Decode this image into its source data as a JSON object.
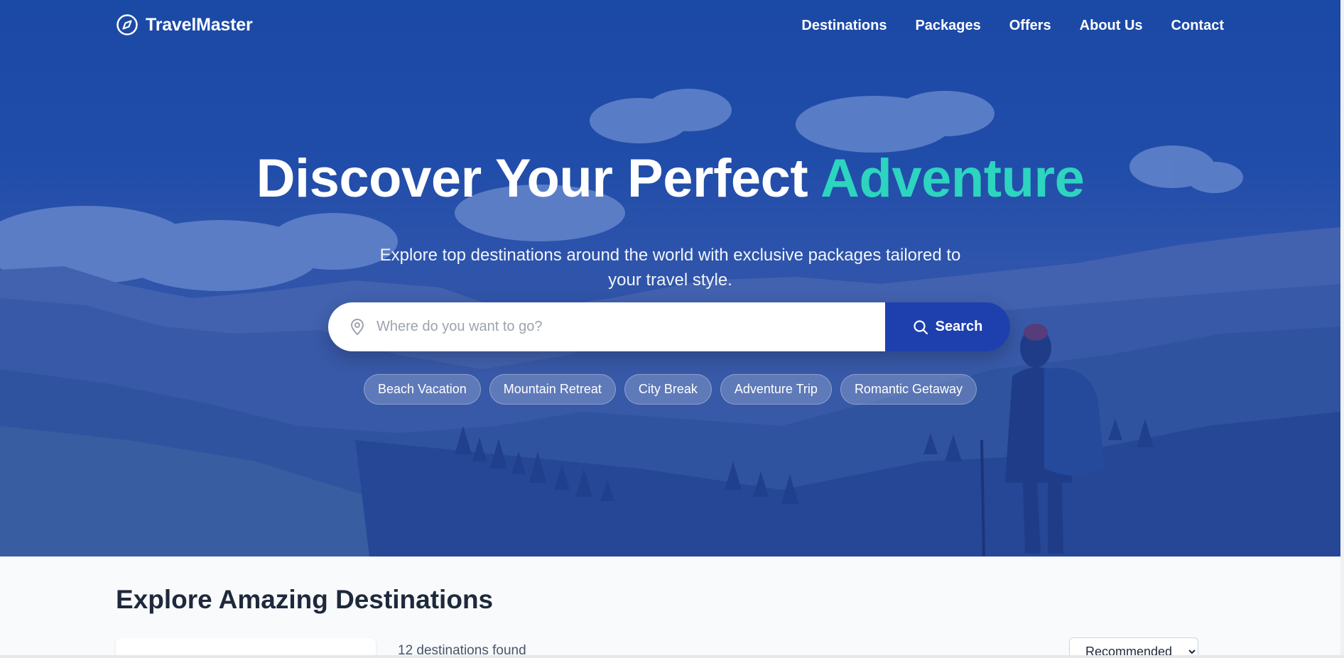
{
  "brand": {
    "name": "TravelMaster",
    "icon": "compass-icon"
  },
  "nav": {
    "links": [
      "Destinations",
      "Packages",
      "Offers",
      "About Us",
      "Contact"
    ]
  },
  "hero": {
    "title_main": "Discover Your Perfect ",
    "title_accent": "Adventure",
    "subtitle": "Explore top destinations around the world with exclusive packages tailored to your travel style.",
    "search": {
      "placeholder": "Where do you want to go?",
      "value": "",
      "button_label": "Search",
      "location_icon": "map-pin-icon",
      "button_icon": "search-icon"
    },
    "chips": [
      "Beach Vacation",
      "Mountain Retreat",
      "City Break",
      "Adventure Trip",
      "Romantic Getaway"
    ]
  },
  "destinations": {
    "title": "Explore Amazing Destinations",
    "results_count": "12 destinations found",
    "sort_selected": "Recommended"
  },
  "colors": {
    "primary": "#1e40af",
    "accent": "#2dd4bf",
    "heading": "#1e293b"
  }
}
